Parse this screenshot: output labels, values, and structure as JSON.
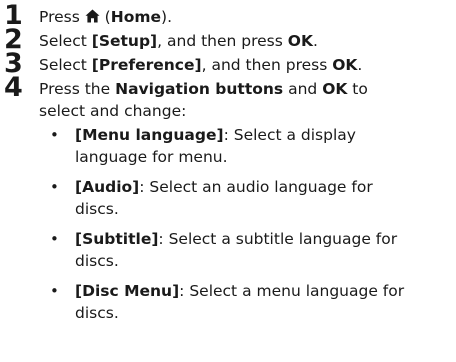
{
  "steps": [
    {
      "number": "1",
      "parts": [
        "Press ",
        "(",
        "Home",
        ")."
      ],
      "icon": "home-icon"
    },
    {
      "number": "2",
      "parts": [
        "Select ",
        "[Setup]",
        ", and then press ",
        "OK",
        "."
      ]
    },
    {
      "number": "3",
      "parts": [
        "Select ",
        "[Preference]",
        ", and then press ",
        "OK",
        "."
      ]
    },
    {
      "number": "4",
      "parts": [
        "Press the ",
        "Navigation buttons",
        " and ",
        "OK",
        " to",
        "select and change:"
      ]
    }
  ],
  "bullets": [
    {
      "symbol": "•",
      "label": "[Menu language]",
      "text": ": Select a display",
      "text2": "language for menu."
    },
    {
      "symbol": "•",
      "label": "[Audio]",
      "text": ": Select an audio language for",
      "text2": "discs."
    },
    {
      "symbol": "•",
      "label": "[Subtitle]",
      "text": ": Select a subtitle language for",
      "text2": "discs."
    },
    {
      "symbol": "•",
      "label": "[Disc Menu]",
      "text": ": Select a menu language for",
      "text2": "discs."
    }
  ]
}
